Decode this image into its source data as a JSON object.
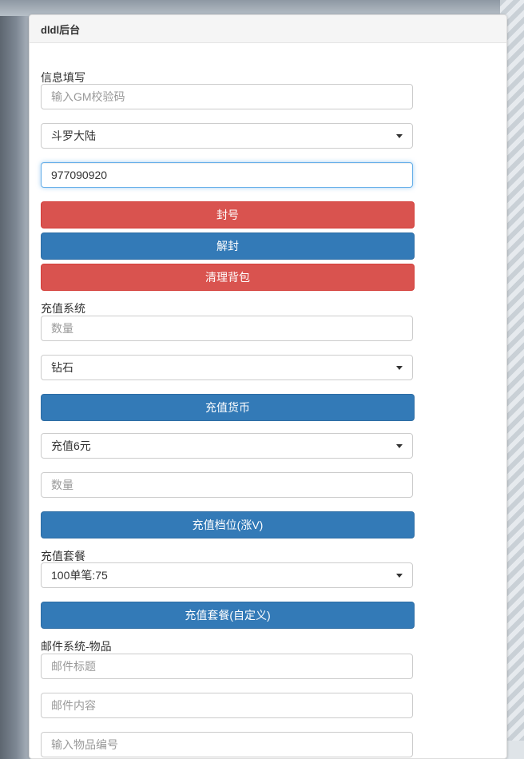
{
  "panel": {
    "title": "dldl后台"
  },
  "info": {
    "section_label": "信息填写",
    "gm_code_placeholder": "输入GM校验码",
    "server_select": "斗罗大陆",
    "player_id_value": "977090920",
    "ban_button": "封号",
    "unban_button": "解封",
    "clear_bag_button": "清理背包"
  },
  "recharge": {
    "section_label": "充值系统",
    "amount_placeholder": "数量",
    "currency_select": "钻石",
    "currency_button": "充值货币",
    "tier_select": "充值6元",
    "tier_amount_placeholder": "数量",
    "tier_button": "充值档位(涨V)"
  },
  "package": {
    "section_label": "充值套餐",
    "package_select": "100单笔:75",
    "package_button": "充值套餐(自定义)"
  },
  "mail": {
    "section_label": "邮件系统-物品",
    "title_placeholder": "邮件标题",
    "content_placeholder": "邮件内容",
    "item_placeholder": "输入物品编号"
  },
  "colors": {
    "danger": "#d9534f",
    "primary": "#337ab7",
    "focus_border": "#66afe9"
  }
}
